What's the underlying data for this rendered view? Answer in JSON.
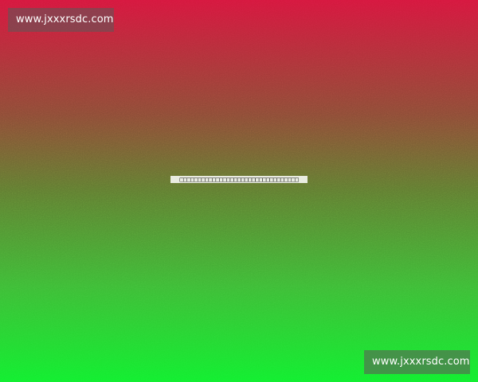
{
  "watermarks": {
    "top_left": "www.jxxxrsdc.com",
    "bottom_right": "www.jxxxrsdc.com"
  },
  "center_text": "□□□□□□□□□□□□□□□□□□□□□□□□□□□□□□□□□",
  "colors": {
    "gradient_top": "#d4173c",
    "gradient_middle": "#5e7a30",
    "gradient_bottom": "#12ee2e"
  }
}
